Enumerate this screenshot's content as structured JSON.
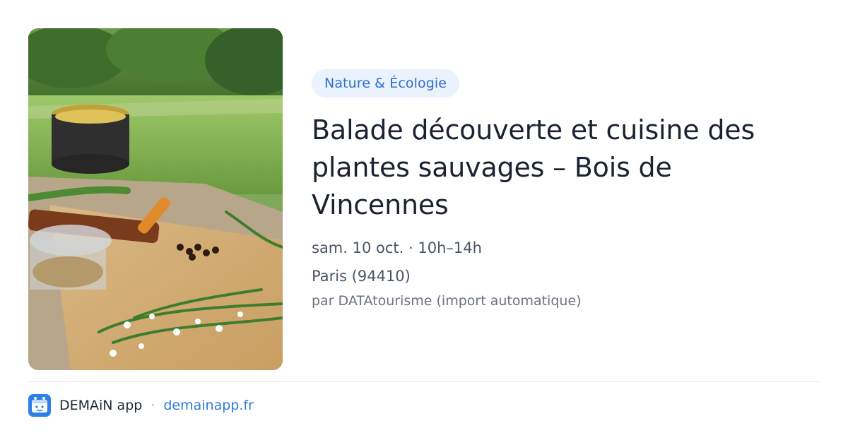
{
  "card": {
    "category": "Nature & Écologie",
    "title": "Balade découverte et cuisine des plantes sauvages – Bois de Vincennes",
    "date": "sam. 10 oct. · 10h–14h",
    "location": "Paris (94410)",
    "source": "par DATAtourisme (import automatique)",
    "image_icon": "event-photo"
  },
  "footer": {
    "app_name": "DEMAiN app",
    "separator": "·",
    "domain": "demainapp.fr",
    "app_icon": "demain-logo-icon"
  },
  "colors": {
    "accent": "#2f6fce",
    "badge_bg": "#e9f2fd",
    "title": "#1b2333",
    "meta": "#4b5563"
  }
}
